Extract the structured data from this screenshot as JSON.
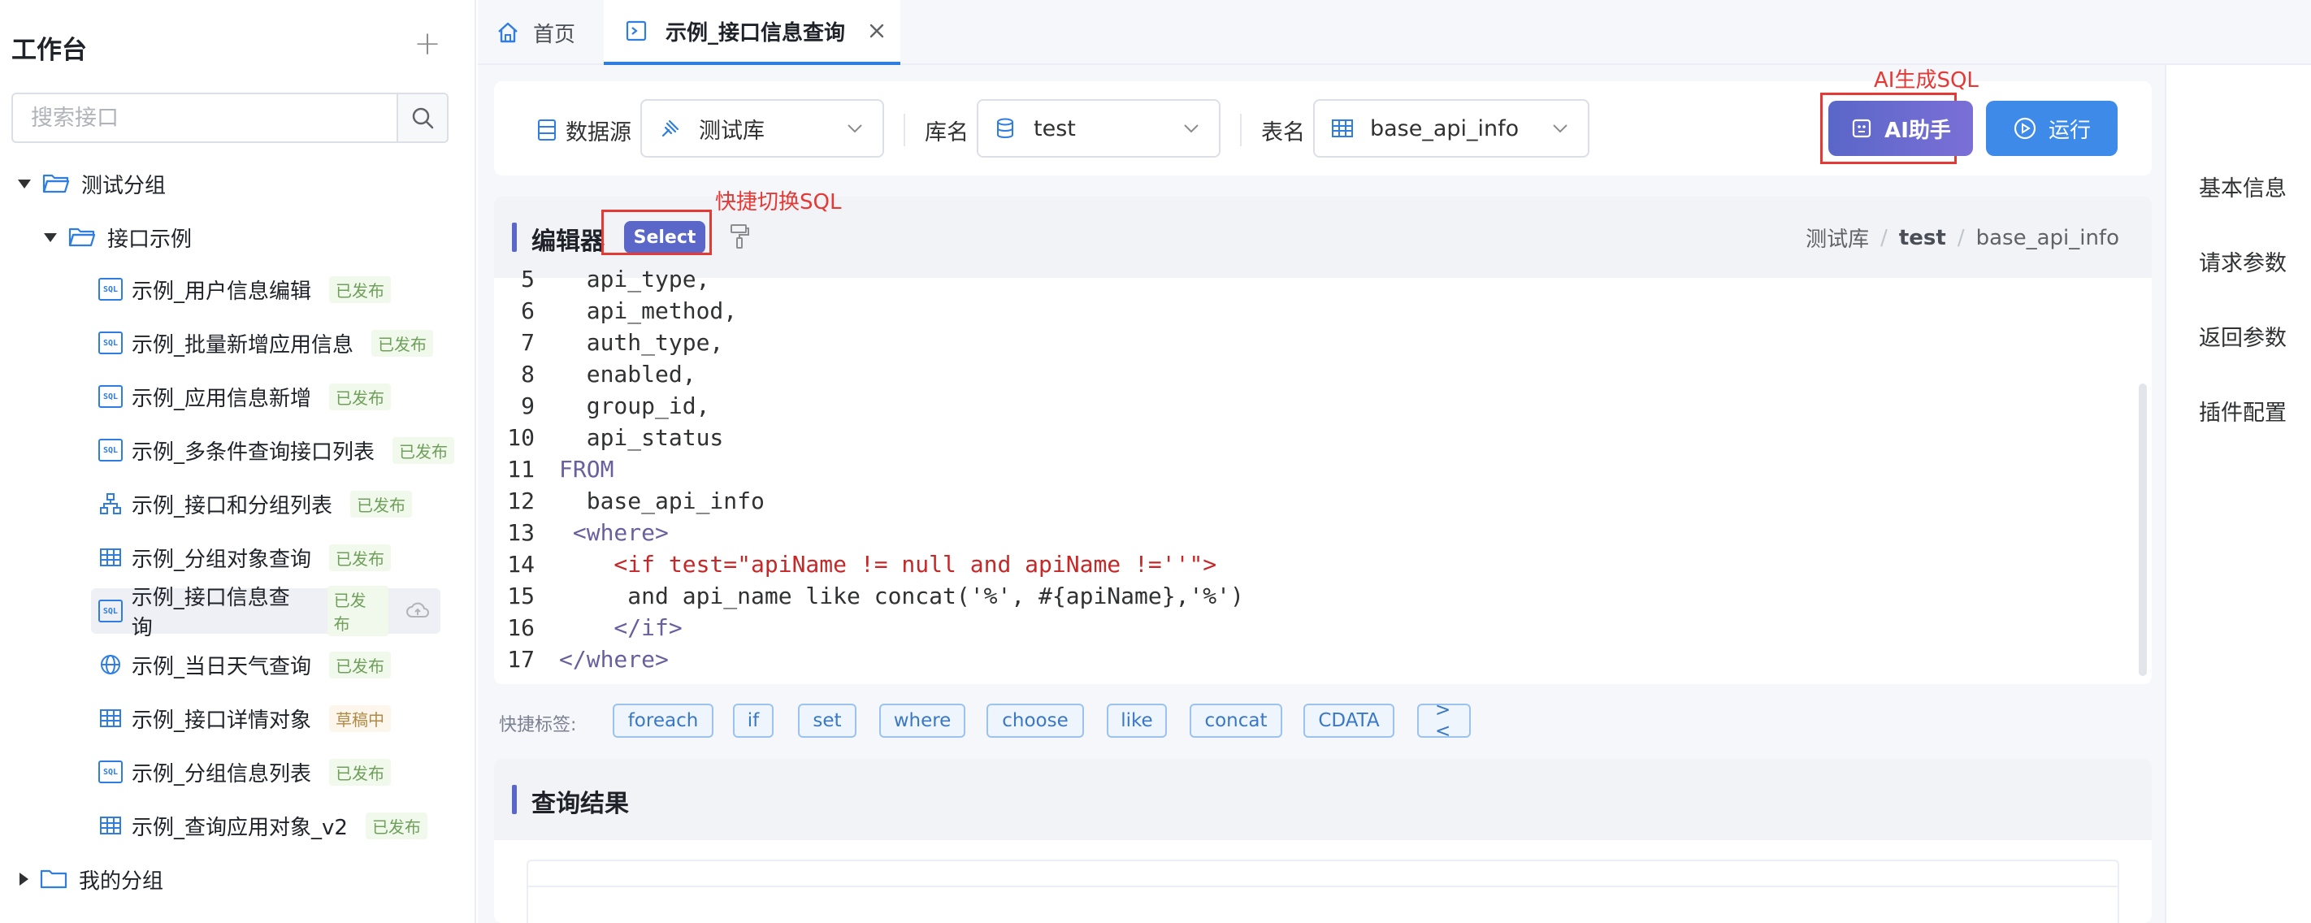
{
  "sidebar": {
    "title": "工作台",
    "search_placeholder": "搜索接口",
    "groups": [
      {
        "label": "测试分组"
      },
      {
        "label": "接口示例"
      },
      {
        "label": "我的分组"
      }
    ],
    "items": [
      {
        "label": "示例_用户信息编辑",
        "status": "已发布",
        "icon": "sql-icon"
      },
      {
        "label": "示例_批量新增应用信息",
        "status": "已发布",
        "icon": "sql-icon"
      },
      {
        "label": "示例_应用信息新增",
        "status": "已发布",
        "icon": "sql-icon"
      },
      {
        "label": "示例_多条件查询接口列表",
        "status": "已发布",
        "icon": "sql-icon"
      },
      {
        "label": "示例_接口和分组列表",
        "status": "已发布",
        "icon": "hierarchy-icon"
      },
      {
        "label": "示例_分组对象查询",
        "status": "已发布",
        "icon": "table-icon"
      },
      {
        "label": "示例_接口信息查询",
        "status": "已发布",
        "icon": "sql-icon"
      },
      {
        "label": "示例_当日天气查询",
        "status": "已发布",
        "icon": "globe-icon"
      },
      {
        "label": "示例_接口详情对象",
        "status": "草稿中",
        "icon": "table-icon"
      },
      {
        "label": "示例_分组信息列表",
        "status": "已发布",
        "icon": "sql-icon"
      },
      {
        "label": "示例_查询应用对象_v2",
        "status": "已发布",
        "icon": "table-icon"
      }
    ]
  },
  "tabs": [
    {
      "label": "首页",
      "icon": "home-icon"
    },
    {
      "label": "示例_接口信息查询",
      "icon": "terminal-icon"
    }
  ],
  "toolbar": {
    "datasource_label": "数据源",
    "datasource_value": "测试库",
    "db_label": "库名",
    "db_value": "test",
    "table_label": "表名",
    "table_value": "base_api_info",
    "ai_button": "AI助手",
    "run_button": "运行"
  },
  "annotations": {
    "ai": "AI生成SQL",
    "switch": "快捷切换SQL"
  },
  "editor": {
    "title": "编辑器",
    "mode_chip": "Select",
    "breadcrumb": [
      "测试库",
      "test",
      "base_api_info"
    ],
    "lines": [
      {
        "n": "5",
        "text": "  api_type,"
      },
      {
        "n": "6",
        "text": "  api_method,"
      },
      {
        "n": "7",
        "text": "  auth_type,"
      },
      {
        "n": "8",
        "text": "  enabled,"
      },
      {
        "n": "9",
        "text": "  group_id,"
      },
      {
        "n": "10",
        "text": "  api_status"
      },
      {
        "n": "11",
        "text": "FROM"
      },
      {
        "n": "12",
        "text": "  base_api_info"
      },
      {
        "n": "13",
        "text": " <where>"
      },
      {
        "n": "14",
        "text": "    <if test=\"apiName != null and apiName !=''\">"
      },
      {
        "n": "15",
        "text": "     and api_name like concat('%', #{apiName},'%')"
      },
      {
        "n": "16",
        "text": "    </if>"
      },
      {
        "n": "17",
        "text": "</where>"
      }
    ]
  },
  "quick_tags": {
    "label": "快捷标签:",
    "tags": [
      "foreach",
      "if",
      "set",
      "where",
      "choose",
      "like",
      "concat",
      "CDATA",
      "><"
    ]
  },
  "result": {
    "title": "查询结果"
  },
  "right_panel": {
    "items": [
      "基本信息",
      "请求参数",
      "返回参数",
      "插件配置"
    ]
  },
  "colors": {
    "primary": "#3d8ae8",
    "ai_gradient": "#5a67c8",
    "annotation": "#e53935"
  }
}
